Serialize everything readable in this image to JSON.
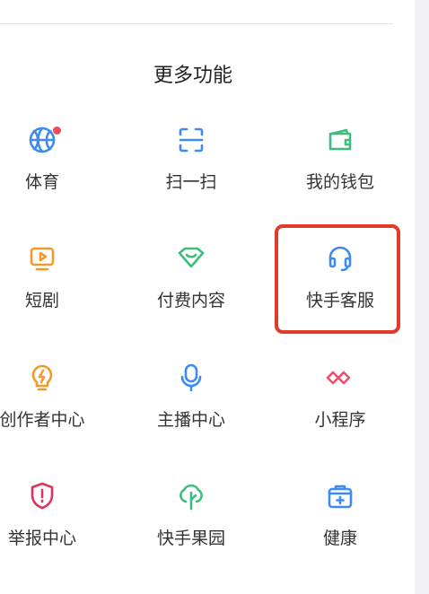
{
  "section_title": "更多功能",
  "items": [
    {
      "label": "体育",
      "icon": "basketball-icon",
      "color": "#3d8bf0",
      "badge": true
    },
    {
      "label": "扫一扫",
      "icon": "scan-icon",
      "color": "#3d8bf0"
    },
    {
      "label": "我的钱包",
      "icon": "wallet-icon",
      "color": "#3dbd7d"
    },
    {
      "label": "短剧",
      "icon": "tv-play-icon",
      "color": "#f29a2e"
    },
    {
      "label": "付费内容",
      "icon": "diamond-smile-icon",
      "color": "#3dbd7d"
    },
    {
      "label": "快手客服",
      "icon": "headset-icon",
      "color": "#3d8bf0"
    },
    {
      "label": "创作者中心",
      "icon": "bulb-icon",
      "color": "#f29a2e"
    },
    {
      "label": "主播中心",
      "icon": "microphone-icon",
      "color": "#3d8bf0"
    },
    {
      "label": "小程序",
      "icon": "infinity-icon",
      "color": "#f0506e"
    },
    {
      "label": "举报中心",
      "icon": "shield-alert-icon",
      "color": "#e0325e"
    },
    {
      "label": "快手果园",
      "icon": "tree-icon",
      "color": "#3dbd7d"
    },
    {
      "label": "健康",
      "icon": "medical-kit-icon",
      "color": "#3d8bf0"
    }
  ],
  "highlight_color": "#e23b2a"
}
